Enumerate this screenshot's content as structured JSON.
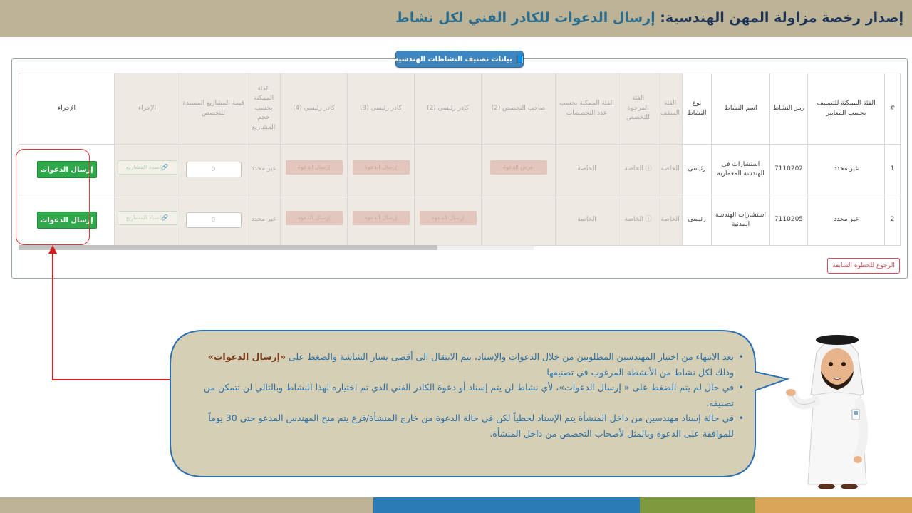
{
  "header": {
    "title_main": "إصدار رخصة مزاولة المهن الهندسية: ",
    "title_highlight": "إرسال الدعوات للكادر الفني لكل نشاط"
  },
  "panel": {
    "legend": "بيانات تصنيف النشاطات الهندسية"
  },
  "table": {
    "headers": {
      "index": "#",
      "category": "الفئة الممكنة للتصنيف بحسب المعايير",
      "code": "رمز النشاط",
      "name": "اسم النشاط",
      "type": "نوع النشاط",
      "ceiling": "الفئة السقف",
      "desired": "الفئة المرجوة للتخصص",
      "by_specialties": "الفئة الممكنة بحسب عدد التخصصات",
      "owner2": "صاحب التخصص (2)",
      "lead2": "كادر رئيسي (2)",
      "lead3": "كادر رئيسي (3)",
      "lead4": "كادر رئيسي (4)",
      "by_volume": "الفئة الممكنة بحسب حجم المشاريع",
      "projects_value": "قيمة المشاريع المسندة للتخصص",
      "action1": "الإجراء",
      "action2": "الإجراء"
    },
    "rows": [
      {
        "index": "1",
        "category": "غير محدد",
        "code": "7110202",
        "name": "استشارات في الهندسة المعمارية",
        "type": "رئيسي",
        "ceiling": "الخاصة",
        "desired": "الخاصة",
        "by_specialties": "الخاصة",
        "owner2": "عرض الدعوة",
        "lead2": "",
        "lead3": "إرسال الدعوة",
        "lead4": "إرسال الدعوة",
        "by_volume": "غير محدد",
        "projects_value": "0",
        "assign": "إسناد المشاريع",
        "invite": "إرسال الدعوات"
      },
      {
        "index": "2",
        "category": "غير محدد",
        "code": "7110205",
        "name": "استشارات الهندسة المدنية",
        "type": "رئيسي",
        "ceiling": "الخاصة",
        "desired": "الخاصة",
        "by_specialties": "الخاصة",
        "owner2": "",
        "lead2": "إرسال الدعوة",
        "lead3": "إرسال الدعوة",
        "lead4": "إرسال الدعوة",
        "by_volume": "غير محدد",
        "projects_value": "0",
        "assign": "إسناد المشاريع",
        "invite": "إرسال الدعوات"
      }
    ]
  },
  "back_button": "الرجوع للخطوة السابقة",
  "callout": {
    "bullet1_a": "بعد الانتهاء من اختيار المهندسين المطلوبين من خلال الدعوات والإسناد، يتم الانتقال الى أقصى يسار الشاشة والضغط على ",
    "bullet1_em": "«إرسال الدعوات»",
    "bullet1_b": " وذلك لكل نشاط من الأنشطة المرغوب في تصنيفها",
    "bullet2": "في حال لم يتم الضغط على « إرسال الدعوات»، لأي نشاط لن يتم إسناد أو دعوة الكادر الفني الذي تم اختياره لهذا النشاط وبالتالي لن تتمكن من تصنيفه.",
    "bullet3": "في حالة إسناد مهندسين من داخل المنشأة يتم الإسناد لحظياً لكن في حالة الدعوة من خارج المنشأة/فرع يتم منح المهندس المدعو حتى 30 يوماً للموافقة على الدعوة وبالمثل لأصحاب التخصص من داخل المنشأة."
  },
  "colors": {
    "header_bg": "#bdb497",
    "legend_bg": "#3f86c0",
    "invite_green": "#2ea84a",
    "highlight_red": "#e03a3a",
    "bubble_bg": "#d5cfb5",
    "footer": [
      "#bdb497",
      "#2b7bb6",
      "#7f9a3e",
      "#d9a659"
    ]
  }
}
